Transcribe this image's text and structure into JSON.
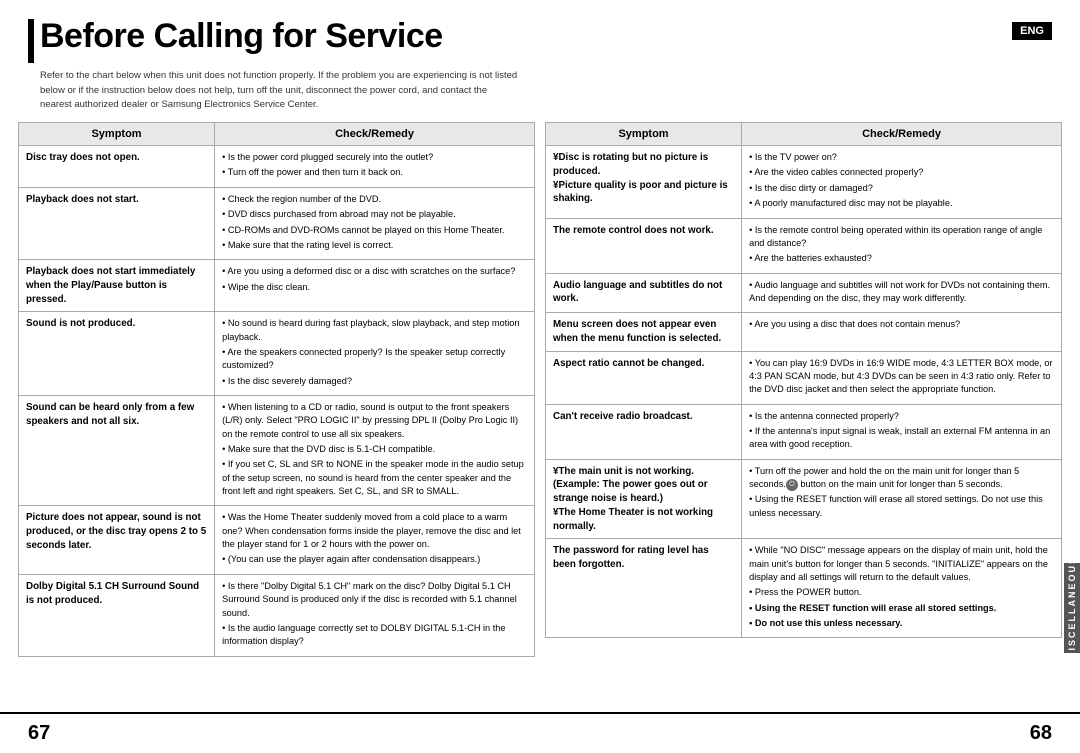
{
  "header": {
    "title_accent": "|",
    "title": "Before Calling for Service",
    "lang_badge": "ENG",
    "description": "Refer to the chart below when this unit does not function properly. If the problem you are experiencing is not listed below or if the instruction below does not help, turn off the unit, disconnect the power cord, and contact the nearest authorized dealer or Samsung Electronics Service Center."
  },
  "left_table": {
    "col1_header": "Symptom",
    "col2_header": "Check/Remedy",
    "rows": [
      {
        "symptom": "Disc tray does not open.",
        "remedies": [
          "Is the power cord plugged securely into the outlet?",
          "Turn off the power and then turn it back on."
        ]
      },
      {
        "symptom": "Playback does not start.",
        "remedies": [
          "Check the region number of the DVD.",
          "DVD discs purchased from abroad may not be playable.",
          "CD-ROMs and DVD-ROMs cannot be played on this Home Theater.",
          "Make sure that the rating level is correct."
        ]
      },
      {
        "symptom": "Playback does not start immediately when the Play/Pause button is pressed.",
        "remedies": [
          "Are you using a deformed disc or a disc with scratches on the surface?",
          "Wipe the disc clean."
        ]
      },
      {
        "symptom": "Sound is not produced.",
        "remedies": [
          "No sound is heard during fast playback, slow playback, and step motion playback.",
          "Are the speakers connected properly? Is the speaker setup correctly customized?",
          "Is the disc severely damaged?"
        ]
      },
      {
        "symptom": "Sound can be heard only from a few speakers and not all six.",
        "remedies": [
          "When listening to a CD or radio, sound is output to the front speakers (L/R) only. Select \"PRO LOGIC II\" by pressing DPL II (Dolby Pro Logic II) on the remote control to use all six speakers.",
          "Make sure that the DVD disc is 5.1-CH compatible.",
          "If you set C, SL and SR to NONE in the speaker mode in the audio setup of the setup screen, no sound is heard from the center speaker and the front left and right speakers. Set C, SL, and SR to SMALL."
        ]
      },
      {
        "symptom": "Picture does not appear, sound is not produced, or the disc tray opens 2 to 5 seconds later.",
        "remedies": [
          "Was the Home Theater suddenly moved from a cold place to a warm one? When condensation forms inside the player, remove the disc and let the player stand for 1 or 2 hours with the power on.",
          "(You can use the player again after condensation disappears.)"
        ]
      },
      {
        "symptom": "Dolby Digital 5.1 CH Surround Sound is not produced.",
        "remedies": [
          "Is there \"Dolby Digital 5.1 CH\" mark on the disc? Dolby Digital 5.1 CH Surround Sound is produced only if the disc is recorded with 5.1 channel sound.",
          "Is the audio language correctly set to DOLBY DIGITAL 5.1-CH in the information display?"
        ]
      }
    ]
  },
  "right_table": {
    "col1_header": "Symptom",
    "col2_header": "Check/Remedy",
    "rows": [
      {
        "symptom": "¥Disc is rotating but no picture is produced.\n¥Picture quality is poor and picture is shaking.",
        "remedies": [
          "Is the TV power on?",
          "Are the video cables connected properly?",
          "Is the disc dirty or damaged?",
          "A poorly manufactured disc may not be playable."
        ]
      },
      {
        "symptom": "The remote control does not work.",
        "remedies": [
          "Is the remote control being operated within its operation range of angle and distance?",
          "Are the batteries exhausted?"
        ]
      },
      {
        "symptom": "Audio language and subtitles do not work.",
        "remedies": [
          "Audio language and subtitles will not work for DVDs not containing them. And depending on the disc, they may work differently."
        ]
      },
      {
        "symptom": "Menu screen does not appear even when the menu function is selected.",
        "remedies": [
          "Are you using a disc that does not contain menus?"
        ]
      },
      {
        "symptom": "Aspect ratio cannot be changed.",
        "remedies": [
          "You can play 16:9 DVDs in 16:9 WIDE mode, 4:3 LETTER BOX mode, or 4:3 PAN SCAN mode, but 4:3 DVDs can be seen in 4:3 ratio only. Refer to the DVD disc jacket and then select the appropriate function."
        ]
      },
      {
        "symptom": "Can't receive radio broadcast.",
        "remedies": [
          "Is the antenna connected properly?",
          "If the antenna's input signal is weak, install an external FM antenna in an area with good reception."
        ]
      },
      {
        "symptom": "¥The main unit is not working.\n(Example: The power goes out or strange noise is heard.)\n¥The Home Theater is not working normally.",
        "remedies": [
          "Turn off the power and hold the button on the main unit for longer than 5 seconds.",
          "Using the RESET function will erase all stored settings. Do not use this unless necessary."
        ]
      },
      {
        "symptom": "The password for rating level has been forgotten.",
        "remedies": [
          "While \"NO DISC\" message appears on the display of main unit, hold the main unit's button for longer than 5 seconds. \"INITIALIZE\" appears on the display and all settings will return to the default values.",
          "Press the POWER button.",
          "Using the RESET function will erase all stored settings.",
          "Do not use this unless necessary."
        ],
        "last_two_bold": true
      }
    ]
  },
  "footer": {
    "page_left": "67",
    "page_right": "68",
    "sidebar_label": "MISCELLANEOUS"
  }
}
